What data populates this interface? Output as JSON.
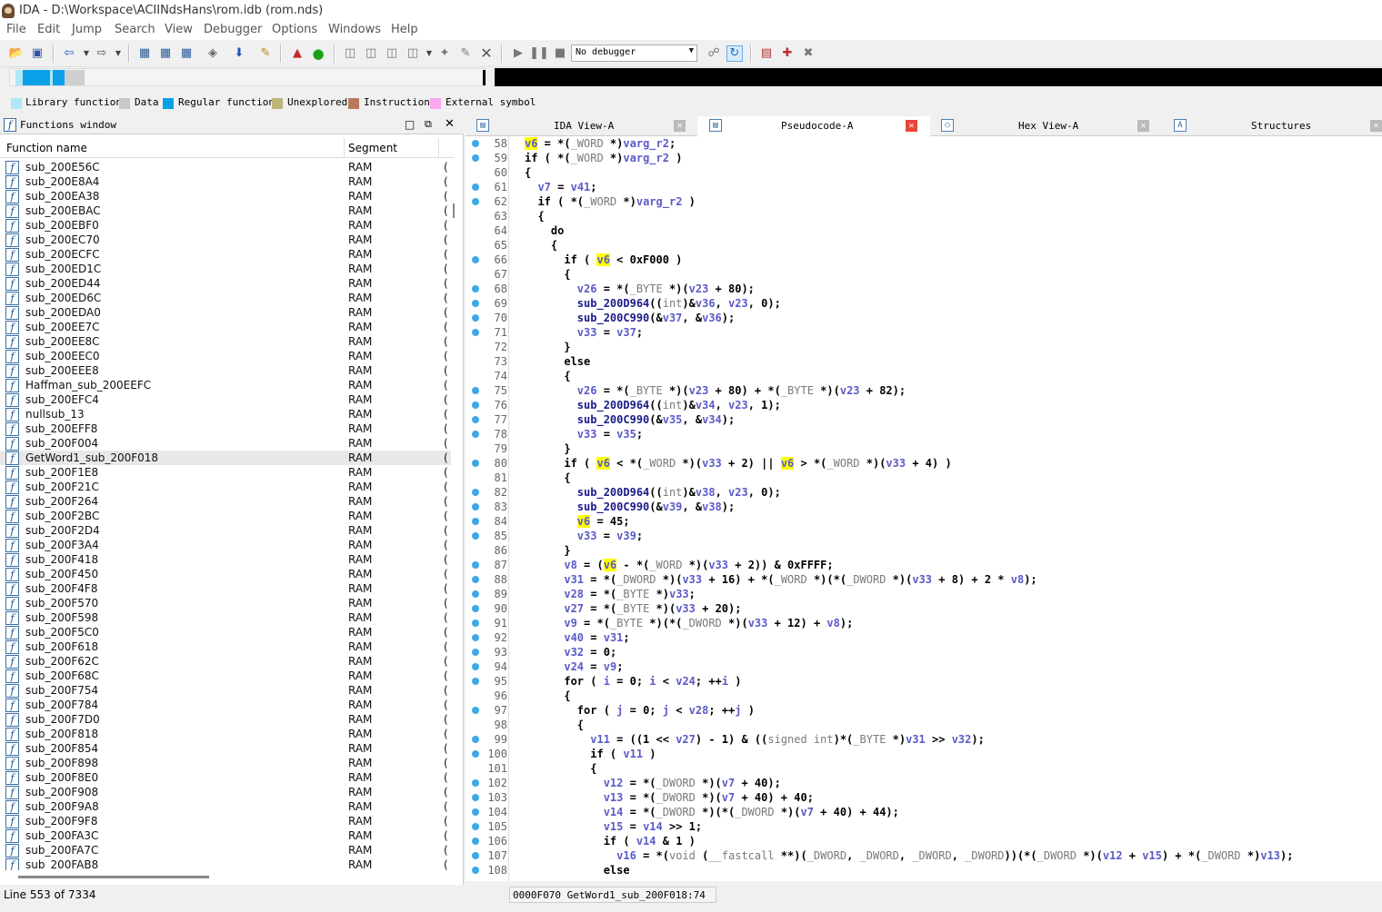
{
  "window": {
    "title": "IDA - D:\\Workspace\\ACIINdsHans\\rom.idb (rom.nds)"
  },
  "menu": [
    "File",
    "Edit",
    "Jump",
    "Search",
    "View",
    "Debugger",
    "Options",
    "Windows",
    "Help"
  ],
  "toolbar": {
    "debugger_select": "No debugger"
  },
  "legend": [
    {
      "label": "Library function",
      "color": "#aee8f8"
    },
    {
      "label": "Data",
      "color": "#c8c8c8"
    },
    {
      "label": "Regular function",
      "color": "#0aa0e8"
    },
    {
      "label": "Unexplored",
      "color": "#bdb67a"
    },
    {
      "label": "Instruction",
      "color": "#b87a5a"
    },
    {
      "label": "External symbol",
      "color": "#f8a8f0"
    }
  ],
  "functions_window": {
    "title": "Functions window",
    "columns": {
      "name": "Function name",
      "segment": "Segment"
    },
    "rows": [
      {
        "name": "sub_200E56C",
        "seg": "RAM"
      },
      {
        "name": "sub_200E8A4",
        "seg": "RAM"
      },
      {
        "name": "sub_200EA38",
        "seg": "RAM"
      },
      {
        "name": "sub_200EBAC",
        "seg": "RAM"
      },
      {
        "name": "sub_200EBF0",
        "seg": "RAM"
      },
      {
        "name": "sub_200EC70",
        "seg": "RAM"
      },
      {
        "name": "sub_200ECFC",
        "seg": "RAM"
      },
      {
        "name": "sub_200ED1C",
        "seg": "RAM"
      },
      {
        "name": "sub_200ED44",
        "seg": "RAM"
      },
      {
        "name": "sub_200ED6C",
        "seg": "RAM"
      },
      {
        "name": "sub_200EDA0",
        "seg": "RAM"
      },
      {
        "name": "sub_200EE7C",
        "seg": "RAM"
      },
      {
        "name": "sub_200EE8C",
        "seg": "RAM"
      },
      {
        "name": "sub_200EEC0",
        "seg": "RAM"
      },
      {
        "name": "sub_200EEE8",
        "seg": "RAM"
      },
      {
        "name": "Haffman_sub_200EEFC",
        "seg": "RAM"
      },
      {
        "name": "sub_200EFC4",
        "seg": "RAM"
      },
      {
        "name": "nullsub_13",
        "seg": "RAM"
      },
      {
        "name": "sub_200EFF8",
        "seg": "RAM"
      },
      {
        "name": "sub_200F004",
        "seg": "RAM"
      },
      {
        "name": "GetWord1_sub_200F018",
        "seg": "RAM",
        "selected": true
      },
      {
        "name": "sub_200F1E8",
        "seg": "RAM"
      },
      {
        "name": "sub_200F21C",
        "seg": "RAM"
      },
      {
        "name": "sub_200F264",
        "seg": "RAM"
      },
      {
        "name": "sub_200F2BC",
        "seg": "RAM"
      },
      {
        "name": "sub_200F2D4",
        "seg": "RAM"
      },
      {
        "name": "sub_200F3A4",
        "seg": "RAM"
      },
      {
        "name": "sub_200F418",
        "seg": "RAM"
      },
      {
        "name": "sub_200F450",
        "seg": "RAM"
      },
      {
        "name": "sub_200F4F8",
        "seg": "RAM"
      },
      {
        "name": "sub_200F570",
        "seg": "RAM"
      },
      {
        "name": "sub_200F598",
        "seg": "RAM"
      },
      {
        "name": "sub_200F5C0",
        "seg": "RAM"
      },
      {
        "name": "sub_200F618",
        "seg": "RAM"
      },
      {
        "name": "sub_200F62C",
        "seg": "RAM"
      },
      {
        "name": "sub_200F68C",
        "seg": "RAM"
      },
      {
        "name": "sub_200F754",
        "seg": "RAM"
      },
      {
        "name": "sub_200F784",
        "seg": "RAM"
      },
      {
        "name": "sub_200F7D0",
        "seg": "RAM"
      },
      {
        "name": "sub_200F818",
        "seg": "RAM"
      },
      {
        "name": "sub_200F854",
        "seg": "RAM"
      },
      {
        "name": "sub_200F898",
        "seg": "RAM"
      },
      {
        "name": "sub_200F8E0",
        "seg": "RAM"
      },
      {
        "name": "sub_200F908",
        "seg": "RAM"
      },
      {
        "name": "sub_200F9A8",
        "seg": "RAM"
      },
      {
        "name": "sub_200F9F8",
        "seg": "RAM"
      },
      {
        "name": "sub_200FA3C",
        "seg": "RAM"
      },
      {
        "name": "sub_200FA7C",
        "seg": "RAM"
      },
      {
        "name": "sub_200FAB8",
        "seg": "RAM"
      }
    ],
    "status": "Line 553 of 7334"
  },
  "tabs": [
    {
      "label": "IDA View-A",
      "active": false
    },
    {
      "label": "Pseudocode-A",
      "active": true
    },
    {
      "label": "Hex View-A",
      "active": false
    },
    {
      "label": "Structures",
      "active": false
    }
  ],
  "code": [
    {
      "n": "58",
      "dot": true,
      "h": "<span class='hl'>v6</span> = *(<span class='t'>_WORD</span> *)<span class='v'>varg_r2</span>;"
    },
    {
      "n": "59",
      "dot": true,
      "h": "if ( *(<span class='t'>_WORD</span> *)<span class='v'>varg_r2</span> )"
    },
    {
      "n": "60",
      "dot": false,
      "h": "{"
    },
    {
      "n": "61",
      "dot": true,
      "h": "  <span class='v'>v7</span> = <span class='v'>v41</span>;"
    },
    {
      "n": "62",
      "dot": true,
      "h": "  if ( *(<span class='t'>_WORD</span> *)<span class='v'>varg_r2</span> )"
    },
    {
      "n": "63",
      "dot": false,
      "h": "  {"
    },
    {
      "n": "64",
      "dot": false,
      "h": "    do"
    },
    {
      "n": "65",
      "dot": false,
      "h": "    {"
    },
    {
      "n": "66",
      "dot": true,
      "h": "      if ( <span class='hl'>v6</span> &lt; 0xF000 )"
    },
    {
      "n": "67",
      "dot": false,
      "h": "      {"
    },
    {
      "n": "68",
      "dot": true,
      "h": "        <span class='v'>v26</span> = *(<span class='t'>_BYTE</span> *)(<span class='v'>v23</span> + 80);"
    },
    {
      "n": "69",
      "dot": true,
      "h": "        <span class='f'>sub_200D964</span>((<span class='t'>int</span>)&amp;<span class='v'>v36</span>, <span class='v'>v23</span>, 0);"
    },
    {
      "n": "70",
      "dot": true,
      "h": "        <span class='f'>sub_200C990</span>(&amp;<span class='v'>v37</span>, &amp;<span class='v'>v36</span>);"
    },
    {
      "n": "71",
      "dot": true,
      "h": "        <span class='v'>v33</span> = <span class='v'>v37</span>;"
    },
    {
      "n": "72",
      "dot": false,
      "h": "      }"
    },
    {
      "n": "73",
      "dot": false,
      "h": "      else"
    },
    {
      "n": "74",
      "dot": false,
      "h": "      {"
    },
    {
      "n": "75",
      "dot": true,
      "h": "        <span class='v'>v26</span> = *(<span class='t'>_BYTE</span> *)(<span class='v'>v23</span> + 80) + *(<span class='t'>_BYTE</span> *)(<span class='v'>v23</span> + 82);"
    },
    {
      "n": "76",
      "dot": true,
      "h": "        <span class='f'>sub_200D964</span>((<span class='t'>int</span>)&amp;<span class='v'>v34</span>, <span class='v'>v23</span>, 1);"
    },
    {
      "n": "77",
      "dot": true,
      "h": "        <span class='f'>sub_200C990</span>(&amp;<span class='v'>v35</span>, &amp;<span class='v'>v34</span>);"
    },
    {
      "n": "78",
      "dot": true,
      "h": "        <span class='v'>v33</span> = <span class='v'>v35</span>;"
    },
    {
      "n": "79",
      "dot": false,
      "h": "      }"
    },
    {
      "n": "80",
      "dot": true,
      "h": "      if ( <span class='hl'>v6</span> &lt; *(<span class='t'>_WORD</span> *)(<span class='v'>v33</span> + 2) || <span class='hl'>v6</span> &gt; *(<span class='t'>_WORD</span> *)(<span class='v'>v33</span> + 4) )"
    },
    {
      "n": "81",
      "dot": false,
      "h": "      {"
    },
    {
      "n": "82",
      "dot": true,
      "h": "        <span class='f'>sub_200D964</span>((<span class='t'>int</span>)&amp;<span class='v'>v38</span>, <span class='v'>v23</span>, 0);"
    },
    {
      "n": "83",
      "dot": true,
      "h": "        <span class='f'>sub_200C990</span>(&amp;<span class='v'>v39</span>, &amp;<span class='v'>v38</span>);"
    },
    {
      "n": "84",
      "dot": true,
      "h": "        <span class='hl'>v6</span> = 45;"
    },
    {
      "n": "85",
      "dot": true,
      "h": "        <span class='v'>v33</span> = <span class='v'>v39</span>;"
    },
    {
      "n": "86",
      "dot": false,
      "h": "      }"
    },
    {
      "n": "87",
      "dot": true,
      "h": "      <span class='v'>v8</span> = (<span class='hl'>v6</span> - *(<span class='t'>_WORD</span> *)(<span class='v'>v33</span> + 2)) &amp; 0xFFFF;"
    },
    {
      "n": "88",
      "dot": true,
      "h": "      <span class='v'>v31</span> = *(<span class='t'>_DWORD</span> *)(<span class='v'>v33</span> + 16) + *(<span class='t'>_WORD</span> *)(*(<span class='t'>_DWORD</span> *)(<span class='v'>v33</span> + 8) + 2 * <span class='v'>v8</span>);"
    },
    {
      "n": "89",
      "dot": true,
      "h": "      <span class='v'>v28</span> = *(<span class='t'>_BYTE</span> *)<span class='v'>v33</span>;"
    },
    {
      "n": "90",
      "dot": true,
      "h": "      <span class='v'>v27</span> = *(<span class='t'>_BYTE</span> *)(<span class='v'>v33</span> + 20);"
    },
    {
      "n": "91",
      "dot": true,
      "h": "      <span class='v'>v9</span> = *(<span class='t'>_BYTE</span> *)(*(<span class='t'>_DWORD</span> *)(<span class='v'>v33</span> + 12) + <span class='v'>v8</span>);"
    },
    {
      "n": "92",
      "dot": true,
      "h": "      <span class='v'>v40</span> = <span class='v'>v31</span>;"
    },
    {
      "n": "93",
      "dot": true,
      "h": "      <span class='v'>v32</span> = 0;"
    },
    {
      "n": "94",
      "dot": true,
      "h": "      <span class='v'>v24</span> = <span class='v'>v9</span>;"
    },
    {
      "n": "95",
      "dot": true,
      "h": "      for ( <span class='v'>i</span> = 0; <span class='v'>i</span> &lt; <span class='v'>v24</span>; ++<span class='v'>i</span> )"
    },
    {
      "n": "96",
      "dot": false,
      "h": "      {"
    },
    {
      "n": "97",
      "dot": true,
      "h": "        for ( <span class='v'>j</span> = 0; <span class='v'>j</span> &lt; <span class='v'>v28</span>; ++<span class='v'>j</span> )"
    },
    {
      "n": "98",
      "dot": false,
      "h": "        {"
    },
    {
      "n": "99",
      "dot": true,
      "h": "          <span class='v'>v11</span> = ((1 &lt;&lt; <span class='v'>v27</span>) - 1) &amp; ((<span class='t'>signed int</span>)*(<span class='t'>_BYTE</span> *)<span class='v'>v31</span> &gt;&gt; <span class='v'>v32</span>);"
    },
    {
      "n": "100",
      "dot": true,
      "h": "          if ( <span class='v'>v11</span> )"
    },
    {
      "n": "101",
      "dot": false,
      "h": "          {"
    },
    {
      "n": "102",
      "dot": true,
      "h": "            <span class='v'>v12</span> = *(<span class='t'>_DWORD</span> *)(<span class='v'>v7</span> + 40);"
    },
    {
      "n": "103",
      "dot": true,
      "h": "            <span class='v'>v13</span> = *(<span class='t'>_DWORD</span> *)(<span class='v'>v7</span> + 40) + 40;"
    },
    {
      "n": "104",
      "dot": true,
      "h": "            <span class='v'>v14</span> = *(<span class='t'>_DWORD</span> *)(*(<span class='t'>_DWORD</span> *)(<span class='v'>v7</span> + 40) + 44);"
    },
    {
      "n": "105",
      "dot": true,
      "h": "            <span class='v'>v15</span> = <span class='v'>v14</span> &gt;&gt; 1;"
    },
    {
      "n": "106",
      "dot": true,
      "h": "            if ( <span class='v'>v14</span> &amp; 1 )"
    },
    {
      "n": "107",
      "dot": true,
      "h": "              <span class='v'>v16</span> = *(<span class='t'>void</span> (<span class='t'>__fastcall</span> **)(<span class='t'>_DWORD</span>, <span class='t'>_DWORD</span>, <span class='t'>_DWORD</span>, <span class='t'>_DWORD</span>))(*(<span class='t'>_DWORD</span> *)(<span class='v'>v12</span> + <span class='v'>v15</span>) + *(<span class='t'>_DWORD</span> *)<span class='v'>v13</span>);"
    },
    {
      "n": "108",
      "dot": true,
      "h": "            else"
    }
  ],
  "status_right": "0000F070 GetWord1_sub_200F018:74"
}
